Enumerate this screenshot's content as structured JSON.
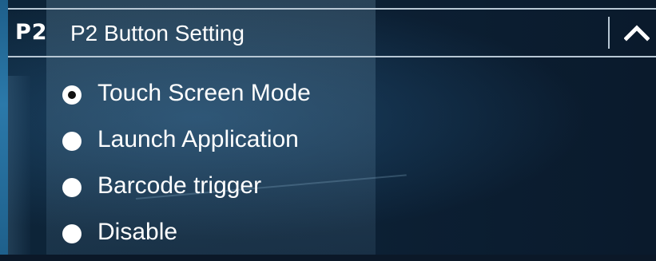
{
  "panel": {
    "badge": "P2",
    "title": "P2 Button Setting",
    "collapse_icon": "chevron-up-icon"
  },
  "options": [
    {
      "label": "Touch Screen Mode",
      "selected": true
    },
    {
      "label": "Launch Application",
      "selected": false
    },
    {
      "label": "Barcode trigger",
      "selected": false
    },
    {
      "label": "Disable",
      "selected": false
    }
  ],
  "colors": {
    "background": "#0c1e33",
    "text": "#ffffff",
    "rule": "#b7c7d4",
    "accent_edge": "#2b79aa"
  }
}
